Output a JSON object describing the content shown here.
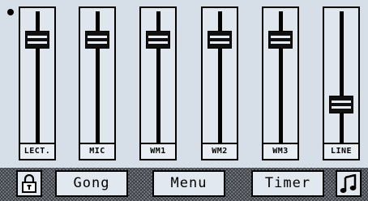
{
  "faders": [
    {
      "label": "LECT.",
      "level": 0.84
    },
    {
      "label": "MIC",
      "level": 0.84
    },
    {
      "label": "WM1",
      "level": 0.84
    },
    {
      "label": "WM2",
      "level": 0.84
    },
    {
      "label": "WM3",
      "level": 0.84
    },
    {
      "label": "LINE",
      "level": 0.27
    }
  ],
  "bottom_bar": {
    "lock_icon": "lock-icon",
    "gong_label": "Gong",
    "menu_label": "Menu",
    "timer_label": "Timer",
    "music_icon": "music-note-icon"
  },
  "colors": {
    "background": "#d6dee8",
    "foreground": "#000000"
  }
}
